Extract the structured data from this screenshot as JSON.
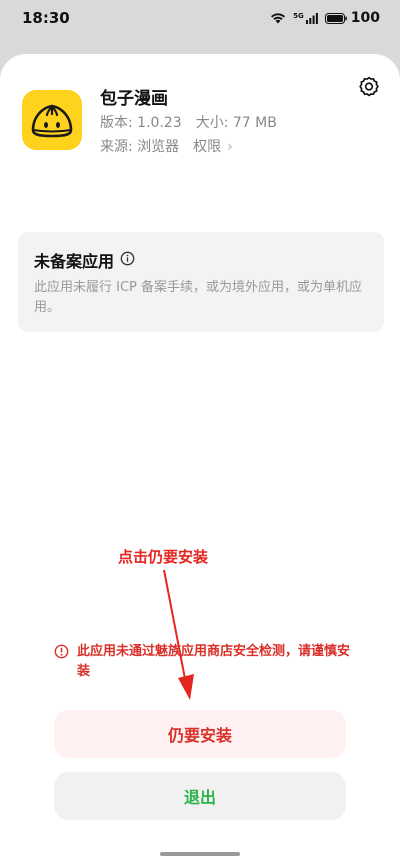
{
  "status_bar": {
    "time": "18:30",
    "network": "5G",
    "battery_level": "100",
    "icons": [
      "wifi-icon",
      "signal-icon",
      "battery-icon"
    ]
  },
  "app": {
    "name": "包子漫画",
    "version_label": "版本: 1.0.23",
    "size_label": "大小: 77 MB",
    "source_label": "来源: 浏览器",
    "permissions_label": "权限",
    "icon_color": "#ffd21e"
  },
  "notice": {
    "title": "未备案应用",
    "body": "此应用未履行 ICP 备案手续，或为境外应用，或为单机应用。"
  },
  "annotation": {
    "text": "点击仍要安装",
    "color": "#e4261f"
  },
  "warning": {
    "text": "此应用未通过魅族应用商店安全检测，请谨慎安装"
  },
  "buttons": {
    "install_anyway": "仍要安装",
    "exit": "退出"
  },
  "colors": {
    "danger": "#d9302a",
    "success": "#2bb349"
  }
}
